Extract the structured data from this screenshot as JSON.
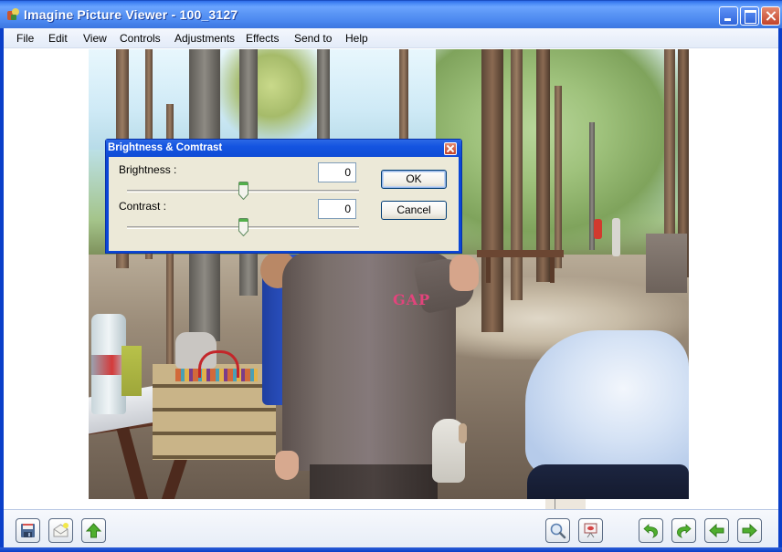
{
  "window": {
    "title": "Imagine Picture Viewer - 100_3127",
    "controls": [
      "minimize",
      "maximize",
      "close"
    ]
  },
  "menubar": {
    "items": [
      {
        "label": "File"
      },
      {
        "label": "Edit"
      },
      {
        "label": "View"
      },
      {
        "label": "Controls"
      },
      {
        "label": "Adjustments"
      },
      {
        "label": "Effects"
      },
      {
        "label": "Send to"
      },
      {
        "label": "Help"
      }
    ]
  },
  "image": {
    "description": "Outdoor photo: picnic area under eucalyptus trees with people, a dog and a picnic table"
  },
  "dialog": {
    "title": "Brightness & Comtrast",
    "brightness": {
      "label": "Brightness :",
      "value": "0",
      "slider_position": 0.5
    },
    "contrast": {
      "label": "Contrast :",
      "value": "0",
      "slider_position": 0.5
    },
    "ok_label": "OK",
    "cancel_label": "Cancel"
  },
  "toolbar": {
    "left": [
      {
        "name": "save-button",
        "icon": "floppy-disk-icon"
      },
      {
        "name": "email-button",
        "icon": "envelope-icon"
      },
      {
        "name": "up-folder-button",
        "icon": "up-arrow-icon"
      }
    ],
    "right": [
      {
        "name": "zoom-button",
        "icon": "magnifier-icon"
      },
      {
        "name": "slideshow-button",
        "icon": "projector-screen-icon"
      },
      {
        "name": "rotate-left-button",
        "icon": "rotate-ccw-icon"
      },
      {
        "name": "rotate-right-button",
        "icon": "rotate-cw-icon"
      },
      {
        "name": "previous-button",
        "icon": "left-arrow-icon"
      },
      {
        "name": "next-button",
        "icon": "right-arrow-icon"
      }
    ]
  },
  "colors": {
    "titlebar": "#4a87ef",
    "dialog_face": "#ece9d8",
    "arrow_green": "#4fae2e"
  }
}
